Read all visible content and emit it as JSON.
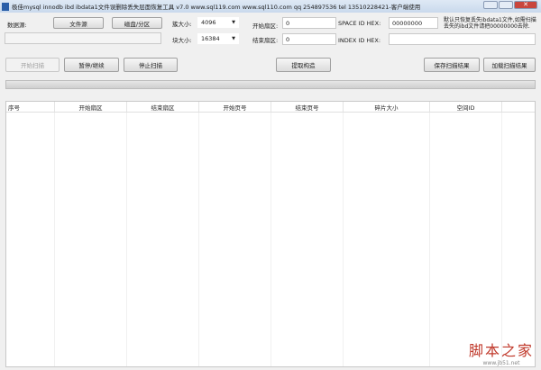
{
  "window": {
    "title": "极佳mysql innodb ibd ibdata1文件误删除丢失层面恢复工具 v7.0 www.sql119.com www.sql110.com qq 254897536 tel 13510228421-客户端使用",
    "close": "✕"
  },
  "source": {
    "label": "数据源:",
    "file_button": "文件源",
    "disk_button": "磁盘/分区",
    "path_value": ""
  },
  "cluster": {
    "label": "簇大小:",
    "value": "4096"
  },
  "block": {
    "label": "块大小:",
    "value": "16384"
  },
  "start_sector": {
    "label": "开始扇区:",
    "value": "0"
  },
  "end_sector": {
    "label": "结束扇区:",
    "value": "0"
  },
  "space_id": {
    "label": "SPACE ID HEX:",
    "value": "00000000"
  },
  "index_id": {
    "label": "INDEX ID HEX:",
    "value": ""
  },
  "note": "默认只恢复丢失ibdata1文件,如需扫描丢失的ibd文件请把00000000去除.",
  "buttons": {
    "start": "开始扫描",
    "pause": "暂停/继续",
    "stop": "停止扫描",
    "extract": "提取构造",
    "save": "保存扫描结果",
    "load": "加载扫描结果"
  },
  "progress": 0,
  "table": {
    "columns": [
      "序号",
      "开始扇区",
      "结束扇区",
      "开始页号",
      "结束页号",
      "碎片大小",
      "空间ID"
    ],
    "rows": []
  },
  "watermark": {
    "text": "脚本之家",
    "url": "www.jb51.net"
  }
}
